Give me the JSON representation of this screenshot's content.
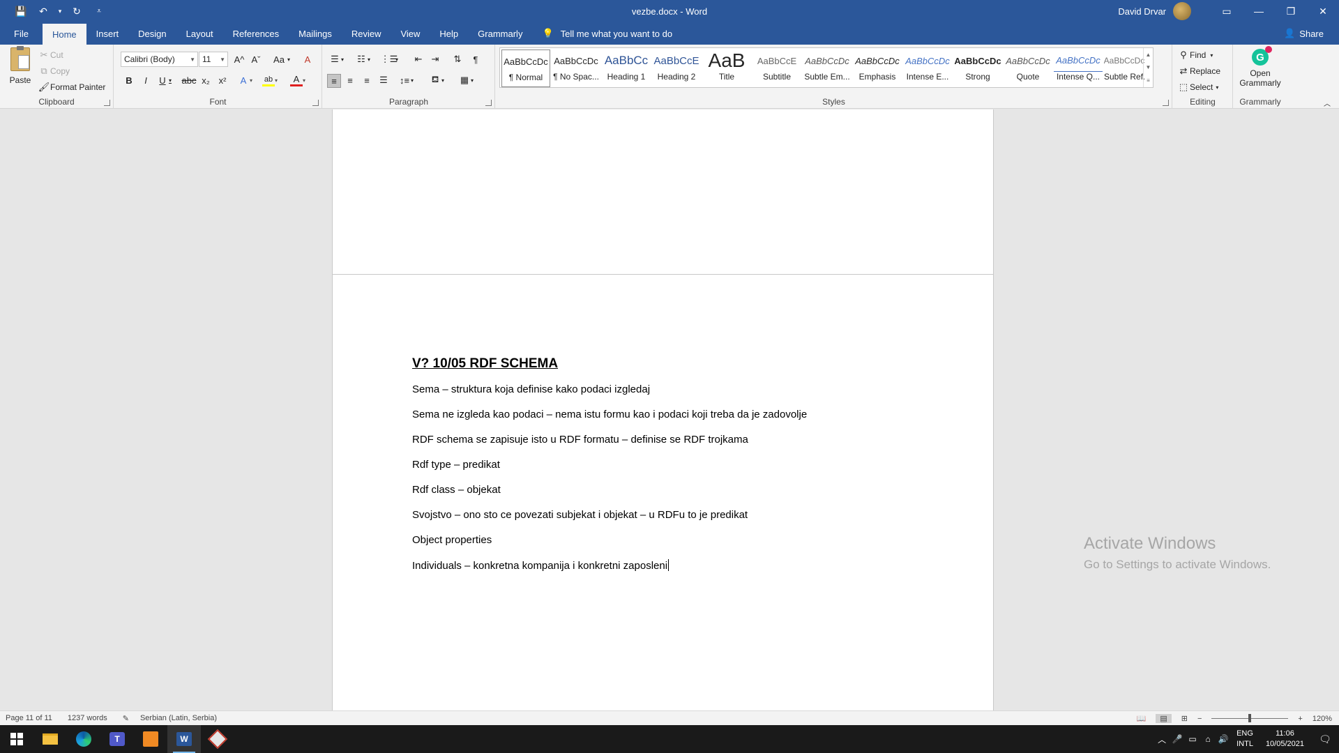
{
  "titlebar": {
    "title": "vezbe.docx - Word",
    "user": "David Drvar",
    "qat": {
      "save": "💾",
      "undo": "↶",
      "undo_drop": "▾",
      "redo": "↻",
      "customize": "⩡"
    },
    "window": {
      "ribbon_opts": "▭",
      "minimize": "—",
      "restore": "❐",
      "close": "✕"
    }
  },
  "tabs": [
    "File",
    "Home",
    "Insert",
    "Design",
    "Layout",
    "References",
    "Mailings",
    "Review",
    "View",
    "Help",
    "Grammarly"
  ],
  "tellme": {
    "icon": "💡",
    "text": "Tell me what you want to do"
  },
  "share": {
    "icon": "👤",
    "label": "Share"
  },
  "clipboard": {
    "label": "Clipboard",
    "paste": "Paste",
    "cut": "Cut",
    "copy": "Copy",
    "format_painter": "Format Painter"
  },
  "font": {
    "label": "Font",
    "font_name": "Calibri (Body)",
    "font_size": "11",
    "bold": "B",
    "italic": "I",
    "underline": "U",
    "strike": "abc",
    "sub": "x₂",
    "sup": "x²",
    "grow": "A^",
    "shrink": "Aˇ",
    "case": "Aa",
    "clear": "A",
    "effects": "A",
    "highlight": "ab",
    "color": "A"
  },
  "paragraph": {
    "label": "Paragraph"
  },
  "styles": {
    "label": "Styles",
    "items": [
      {
        "preview": "AaBbCcDc",
        "name": "¶ Normal"
      },
      {
        "preview": "AaBbCcDc",
        "name": "¶ No Spac..."
      },
      {
        "preview": "AaBbCc",
        "name": "Heading 1"
      },
      {
        "preview": "AaBbCcE",
        "name": "Heading 2"
      },
      {
        "preview": "AaB",
        "name": "Title"
      },
      {
        "preview": "AaBbCcE",
        "name": "Subtitle"
      },
      {
        "preview": "AaBbCcDc",
        "name": "Subtle Em..."
      },
      {
        "preview": "AaBbCcDc",
        "name": "Emphasis"
      },
      {
        "preview": "AaBbCcDc",
        "name": "Intense E..."
      },
      {
        "preview": "AaBbCcDc",
        "name": "Strong"
      },
      {
        "preview": "AaBbCcDc",
        "name": "Quote"
      },
      {
        "preview": "AaBbCcDc",
        "name": "Intense Q..."
      },
      {
        "preview": "AaBbCcDc",
        "name": "Subtle Ref..."
      }
    ]
  },
  "editing": {
    "label": "Editing",
    "find": "Find",
    "replace": "Replace",
    "select": "Select"
  },
  "grammarly": {
    "label": "Grammarly",
    "open": "Open",
    "open2": "Grammarly"
  },
  "document": {
    "heading": "V? 10/05 RDF SCHEMA",
    "lines": [
      "Sema – struktura koja definise kako podaci izgledaj",
      "Sema ne izgleda kao podaci – nema istu formu kao i podaci koji treba da je zadovolje",
      "RDF schema se zapisuje isto u RDF formatu – definise se RDF trojkama",
      "Rdf type – predikat",
      "Rdf class – objekat",
      "Svojstvo – ono sto ce povezati subjekat i objekat – u RDFu to je predikat",
      "Object properties",
      "Individuals – konkretna kompanija i konkretni zaposleni"
    ]
  },
  "watermark": {
    "line1": "Activate Windows",
    "line2": "Go to Settings to activate Windows."
  },
  "statusbar": {
    "page": "Page 11 of 11",
    "words": "1237 words",
    "language": "Serbian (Latin, Serbia)",
    "zoom": "120%"
  },
  "taskbar": {
    "lang1": "ENG",
    "lang2": "INTL",
    "time": "11:06",
    "date": "10/05/2021"
  },
  "colors": {
    "accent": "#2b579a",
    "ribbon": "#f3f3f3",
    "canvas": "#e6e6e6"
  }
}
